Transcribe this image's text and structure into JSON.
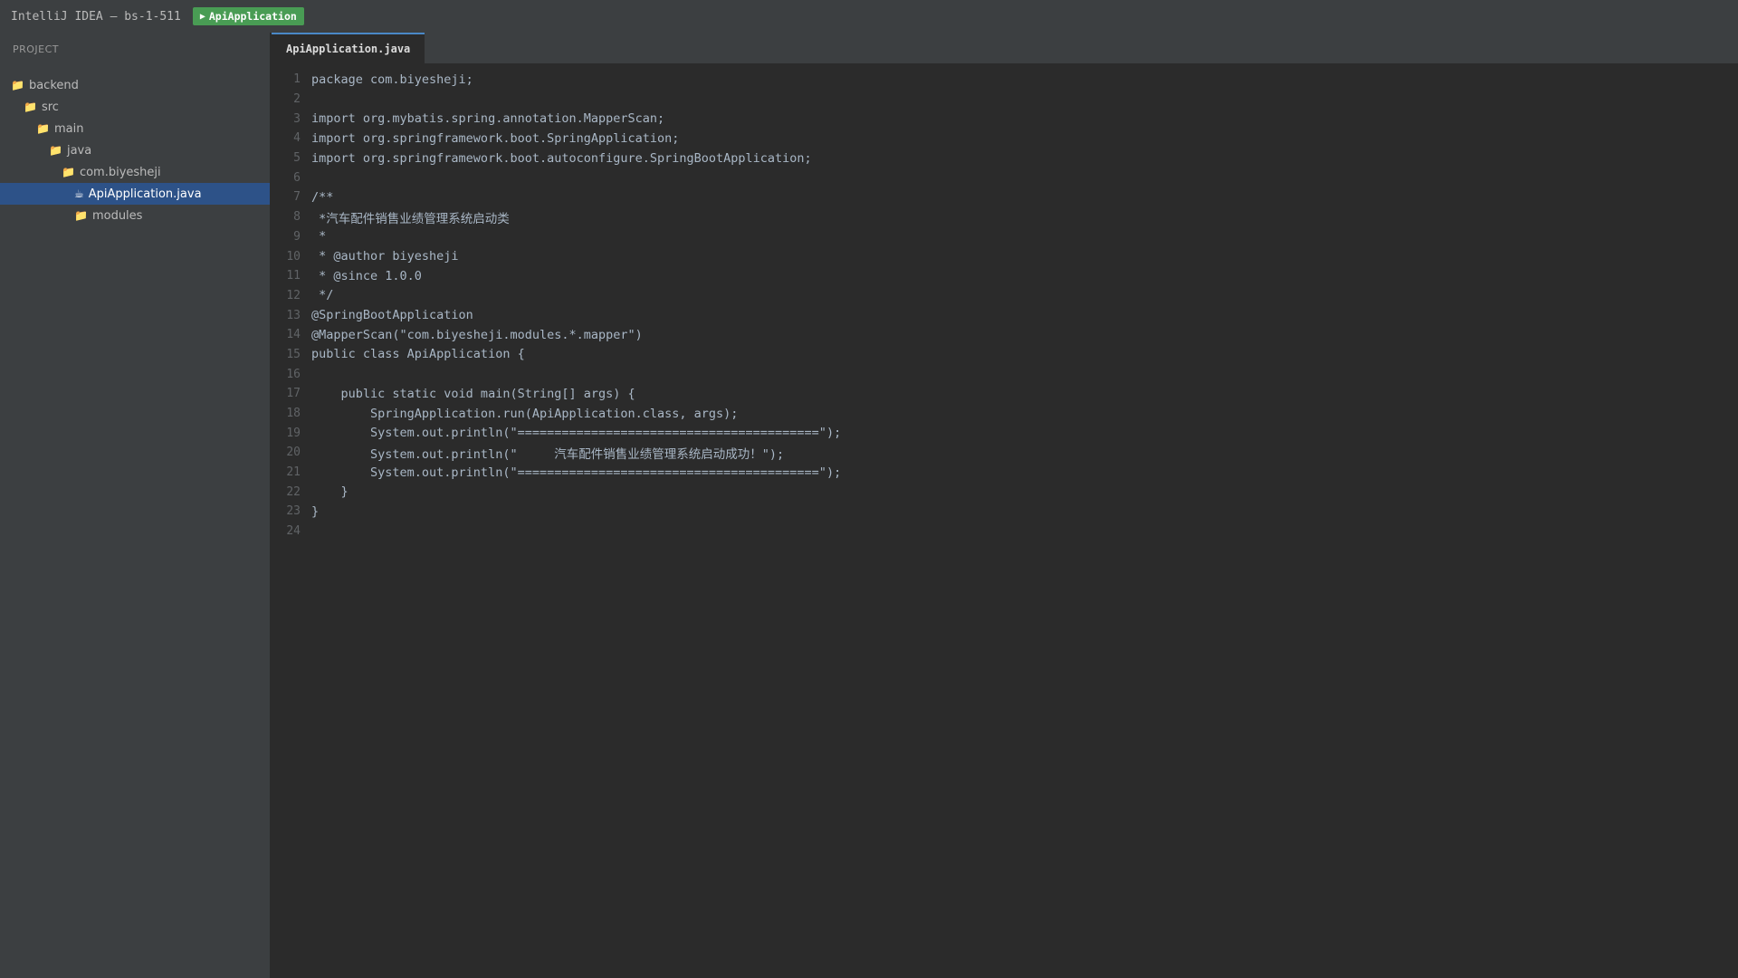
{
  "titlebar": {
    "app_title": "IntelliJ IDEA — bs-1-511",
    "run_config": "ApiApplication",
    "run_icon": "play-icon"
  },
  "sidebar": {
    "header": "PROJECT",
    "items": [
      {
        "label": "backend",
        "icon": "folder-icon",
        "depth": 0
      },
      {
        "label": "src",
        "icon": "folder-icon",
        "depth": 1
      },
      {
        "label": "main",
        "icon": "folder-icon",
        "depth": 2
      },
      {
        "label": "java",
        "icon": "folder-icon",
        "depth": 3
      },
      {
        "label": "com.biyesheji",
        "icon": "folder-icon",
        "depth": 4
      },
      {
        "label": "ApiApplication.java",
        "icon": "java-file-icon",
        "depth": 5,
        "selected": true
      },
      {
        "label": "modules",
        "icon": "folder-icon",
        "depth": 5
      }
    ]
  },
  "editor": {
    "tab_label": "ApiApplication.java",
    "lines": [
      "package com.biyesheji;",
      "",
      "import org.mybatis.spring.annotation.MapperScan;",
      "import org.springframework.boot.SpringApplication;",
      "import org.springframework.boot.autoconfigure.SpringBootApplication;",
      "",
      "/**",
      " *汽车配件销售业绩管理系统启动类",
      " *",
      " * @author biyesheji",
      " * @since 1.0.0",
      " */",
      "@SpringBootApplication",
      "@MapperScan(\"com.biyesheji.modules.*.mapper\")",
      "public class ApiApplication {",
      "",
      "    public static void main(String[] args) {",
      "        SpringApplication.run(ApiApplication.class, args);",
      "        System.out.println(\"=========================================\");",
      "        System.out.println(\"     汽车配件销售业绩管理系统启动成功！\");",
      "        System.out.println(\"=========================================\");",
      "    }",
      "}",
      ""
    ]
  },
  "colors": {
    "background": "#2b2b2b",
    "panel": "#3c3f41",
    "accent": "#4a88c7",
    "run_green": "#499c54",
    "selection": "#2d5288"
  }
}
